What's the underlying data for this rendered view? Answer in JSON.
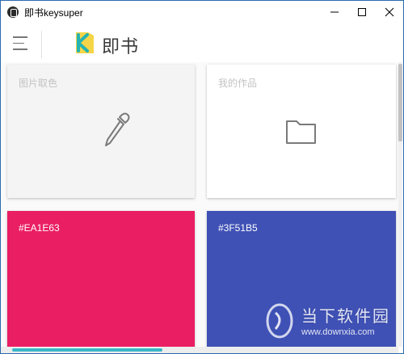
{
  "window": {
    "title": "即书keysuper"
  },
  "header": {
    "brand": "即书"
  },
  "cards": {
    "color_picker_label": "图片取色",
    "my_works_label": "我的作品",
    "swatches": [
      {
        "label": "#EA1E63",
        "color": "#EA1E63"
      },
      {
        "label": "#3F51B5",
        "color": "#3F51B5"
      }
    ]
  },
  "watermark": {
    "name": "当下软件园",
    "url": "www.downxia.com"
  },
  "colors": {
    "logo_yellow": "#F5D547",
    "logo_teal": "#26B3B3",
    "scroll_accent": "#3BB6C8"
  },
  "icons": {
    "menu": "hamburger-icon",
    "picker": "eyedropper-icon",
    "works": "folder-icon"
  }
}
